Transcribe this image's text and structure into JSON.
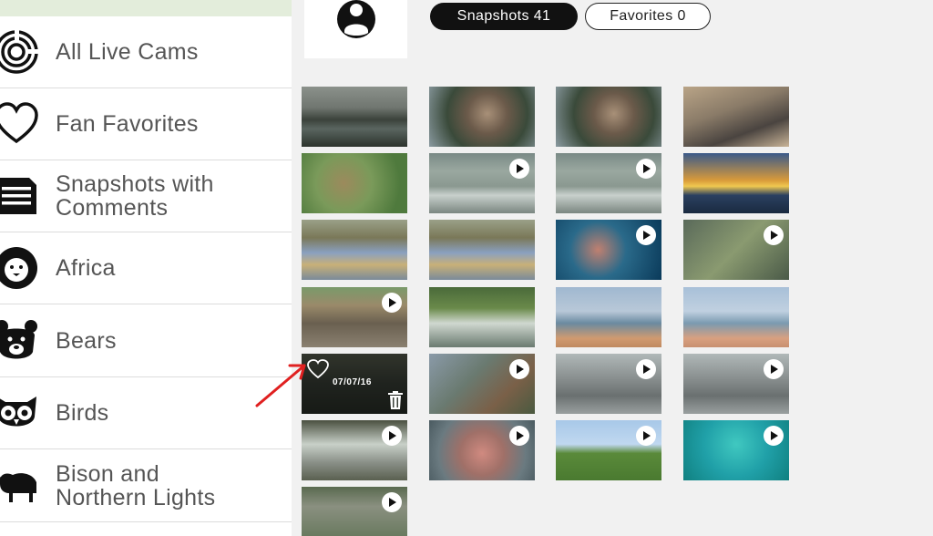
{
  "sidebar": {
    "items": [
      {
        "label": "All Live Cams",
        "icon": "maze-icon"
      },
      {
        "label": "Fan Favorites",
        "icon": "heart-icon"
      },
      {
        "label": "Snapshots with\nComments",
        "icon": "comment-list-icon"
      },
      {
        "label": "Africa",
        "icon": "lion-icon"
      },
      {
        "label": "Bears",
        "icon": "bear-icon"
      },
      {
        "label": "Birds",
        "icon": "owl-icon"
      },
      {
        "label": "Bison and\nNorthern Lights",
        "icon": "bison-icon"
      }
    ]
  },
  "tabs": {
    "snapshots_label": "Snapshots 41",
    "favorites_label": "Favorites 0"
  },
  "thumbnails": [
    {
      "scene": "lake at dusk",
      "play": false
    },
    {
      "scene": "bird nest",
      "play": false
    },
    {
      "scene": "bird nest",
      "play": false
    },
    {
      "scene": "dog on bed",
      "play": false
    },
    {
      "scene": "bird on branch",
      "play": false
    },
    {
      "scene": "seals on shore",
      "play": true
    },
    {
      "scene": "seals on shore",
      "play": true
    },
    {
      "scene": "sunset over sea",
      "play": false
    },
    {
      "scene": "river with grasses",
      "play": false
    },
    {
      "scene": "river with grasses",
      "play": false
    },
    {
      "scene": "diver with fish",
      "play": true
    },
    {
      "scene": "forest foliage",
      "play": true
    },
    {
      "scene": "otters on log",
      "play": true
    },
    {
      "scene": "river rapids",
      "play": false
    },
    {
      "scene": "beach",
      "play": false
    },
    {
      "scene": "beach",
      "play": false
    },
    {
      "scene": "bears in river",
      "play": false,
      "hovered": true,
      "date": "07/07/16"
    },
    {
      "scene": "osprey nest",
      "play": true
    },
    {
      "scene": "puffin rocks",
      "play": true
    },
    {
      "scene": "puffin rocks",
      "play": true
    },
    {
      "scene": "waterfall",
      "play": true
    },
    {
      "scene": "pink piglets",
      "play": true
    },
    {
      "scene": "green field",
      "play": true
    },
    {
      "scene": "underwater reef",
      "play": true
    },
    {
      "scene": "river rocks",
      "play": true
    }
  ],
  "colors": {
    "sidebar_highlight": "#e3eddb",
    "main_background": "#f1f1f1",
    "active_tab": "#111111",
    "annotation_arrow": "#e02020"
  }
}
